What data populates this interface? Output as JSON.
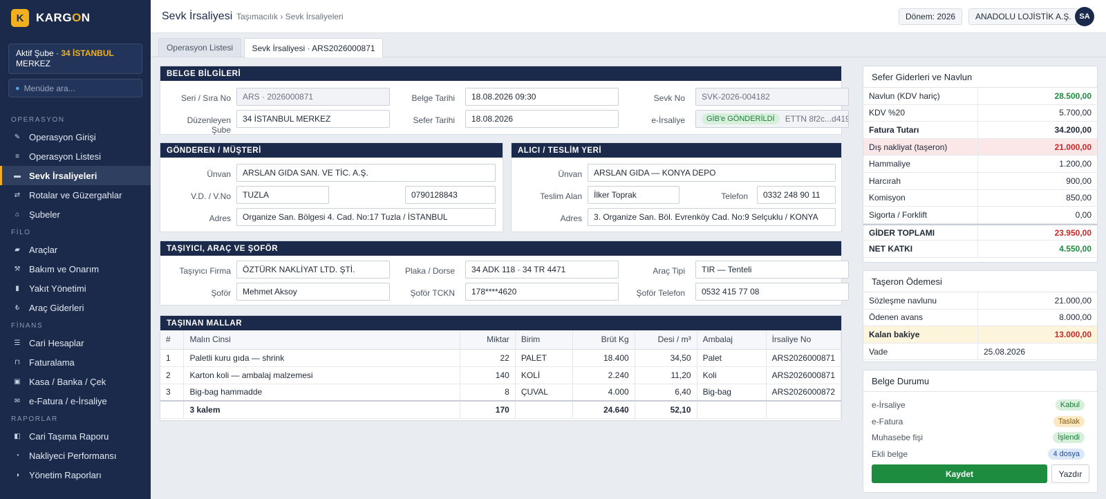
{
  "brand": {
    "logo_letter": "K",
    "name_a": "KARG",
    "name_b": "O",
    "name_c": "N"
  },
  "sidebar": {
    "branch_prefix": "Aktif Şube · ",
    "branch_code": "34 İSTANBUL",
    "branch_rest": "MERKEZ",
    "search_placeholder": "Menüde ara...",
    "sections": [
      {
        "label": "OPERASYON",
        "items": [
          {
            "label": "Operasyon Girişi",
            "icon": "pencil-icon",
            "glyph": "✎"
          },
          {
            "label": "Operasyon Listesi",
            "icon": "list-icon",
            "glyph": "≡"
          },
          {
            "label": "Sevk İrsaliyeleri",
            "icon": "document-icon",
            "glyph": "▬",
            "active": true
          },
          {
            "label": "Rotalar ve Güzergahlar",
            "icon": "swap-icon",
            "glyph": "⇄"
          },
          {
            "label": "Şubeler",
            "icon": "home-icon",
            "glyph": "⌂"
          }
        ]
      },
      {
        "label": "FİLO",
        "items": [
          {
            "label": "Araçlar",
            "icon": "truck-icon",
            "glyph": "▰"
          },
          {
            "label": "Bakım ve Onarım",
            "icon": "tools-icon",
            "glyph": "⚒"
          },
          {
            "label": "Yakıt Yönetimi",
            "icon": "fuel-icon",
            "glyph": "▮"
          },
          {
            "label": "Araç Giderleri",
            "icon": "lira-icon",
            "glyph": "₺"
          }
        ]
      },
      {
        "label": "FİNANS",
        "items": [
          {
            "label": "Cari Hesaplar",
            "icon": "ledger-icon",
            "glyph": "☰"
          },
          {
            "label": "Faturalama",
            "icon": "lock-icon",
            "glyph": "⊓"
          },
          {
            "label": "Kasa / Banka / Çek",
            "icon": "cash-icon",
            "glyph": "▣"
          },
          {
            "label": "e-Fatura / e-İrsaliye",
            "icon": "mail-icon",
            "glyph": "✉"
          }
        ]
      },
      {
        "label": "RAPORLAR",
        "items": [
          {
            "label": "Cari Taşıma Raporu",
            "icon": "report-icon",
            "glyph": "◧"
          },
          {
            "label": "Nakliyeci Performansı",
            "icon": "gauge-icon",
            "glyph": "◔"
          },
          {
            "label": "Yönetim Raporları",
            "icon": "pie-icon",
            "glyph": "◑"
          }
        ]
      }
    ]
  },
  "header": {
    "title": "Sevk İrsaliyesi",
    "breadcrumb": "Taşımacılık › Sevk İrsaliyeleri",
    "period": "Dönem: 2026",
    "company": "ANADOLU LOJİSTİK A.Ş.",
    "avatar": "SA"
  },
  "tabs": [
    "Operasyon Listesi",
    "Sevk İrsaliyesi · ARS2026000871"
  ],
  "doc": {
    "heading": "BELGE BİLGİLERİ",
    "serial_label": "Seri / Sıra No",
    "serial": "ARS · 2026000871",
    "doc_date_label": "Belge Tarihi",
    "doc_date": "18.08.2026 09:30",
    "ship_no_label": "Sevk No",
    "ship_no": "SVK-2026-004182",
    "branch_label": "Düzenleyen Şube",
    "branch": "34 İSTANBUL MERKEZ",
    "trip_date_label": "Sefer Tarihi",
    "trip_date": "18.08.2026",
    "eirs_label": "e-İrsaliye",
    "eirs_badge": "GİB'e GÖNDERİLDİ",
    "ettn": "ETTN 8f2c...d419"
  },
  "sender": {
    "heading": "GÖNDEREN / MÜŞTERİ",
    "title_label": "Ünvan",
    "title": "ARSLAN GIDA SAN. VE TİC. A.Ş.",
    "tax_label": "V.D. / V.No",
    "tax_office": "TUZLA",
    "tax_no": "0790128843",
    "addr_label": "Adres",
    "address": "Organize San. Bölgesi 4. Cad. No:17 Tuzla / İSTANBUL"
  },
  "receiver": {
    "heading": "ALICI / TESLİM YERİ",
    "title_label": "Ünvan",
    "title": "ARSLAN GIDA — KONYA DEPO",
    "recv_label": "Teslim Alan",
    "recv": "İlker Toprak",
    "phone_label": "Telefon",
    "phone": "0332 248 90 11",
    "addr_label": "Adres",
    "address": "3. Organize San. Böl. Evrenköy Cad. No:9 Selçuklu / KONYA"
  },
  "carrier": {
    "heading": "TAŞIYICI, ARAÇ VE ŞOFÖR",
    "firm_label": "Taşıyıcı Firma",
    "firm": "ÖZTÜRK NAKLİYAT LTD. ŞTİ.",
    "plate_label": "Plaka / Dorse",
    "plate": "34 ADK 118 · 34 TR 4471",
    "vtype_label": "Araç Tipi",
    "vtype": "TIR — Tenteli",
    "driver_label": "Şoför",
    "driver": "Mehmet Aksoy",
    "tckn_label": "Şoför TCKN",
    "tckn": "178****4620",
    "dphone_label": "Şoför Telefon",
    "dphone": "0532 415 77 08"
  },
  "goods": {
    "heading": "TAŞINAN MALLAR",
    "columns": [
      "#",
      "Malın Cinsi",
      "Miktar",
      "Birim",
      "Brüt Kg",
      "Desi / m³",
      "Ambalaj",
      "İrsaliye No"
    ],
    "rows": [
      [
        "1",
        "Paletli kuru gıda — shrink",
        "22",
        "PALET",
        "18.400",
        "34,50",
        "Palet",
        "ARS2026000871"
      ],
      [
        "2",
        "Karton koli — ambalaj malzemesi",
        "140",
        "KOLİ",
        "2.240",
        "11,20",
        "Koli",
        "ARS2026000871"
      ],
      [
        "3",
        "Big-bag hammadde",
        "8",
        "ÇUVAL",
        "4.000",
        "6,40",
        "Big-bag",
        "ARS2026000872"
      ]
    ],
    "total": {
      "label": "3 kalem",
      "qty": "170",
      "kg": "24.640",
      "desi": "52,10"
    }
  },
  "costs": {
    "title": "Sefer Giderleri ve Navlun",
    "rows": [
      {
        "label": "Navlun (KDV hariç)",
        "value": "28.500,00",
        "style": "pos"
      },
      {
        "label": "KDV %20",
        "value": "5.700,00"
      },
      {
        "label": "Fatura Tutarı",
        "value": "34.200,00",
        "style": "bold"
      },
      {
        "label": "Dış nakliyat (taşeron)",
        "value": "21.000,00",
        "style": "danger"
      },
      {
        "label": "Hammaliye",
        "value": "1.200,00"
      },
      {
        "label": "Harcırah",
        "value": "900,00"
      },
      {
        "label": "Komisyon",
        "value": "850,00"
      },
      {
        "label": "Sigorta / Forklift",
        "value": "0,00"
      },
      {
        "label": "GİDER TOPLAMI",
        "value": "23.950,00",
        "style": "sum-neg"
      },
      {
        "label": "NET KATKI",
        "value": "4.550,00",
        "style": "bold-pos"
      }
    ]
  },
  "sub": {
    "title": "Taşeron Ödemesi",
    "rows": [
      {
        "label": "Sözleşme navlunu",
        "value": "21.000,00"
      },
      {
        "label": "Ödenen avans",
        "value": "8.000,00"
      },
      {
        "label": "Kalan bakiye",
        "value": "13.000,00",
        "style": "warn"
      },
      {
        "label": "Vade",
        "value": "25.08.2026",
        "style": "date"
      }
    ]
  },
  "status": {
    "title": "Belge Durumu",
    "rows": [
      {
        "label": "e-İrsaliye",
        "badge": "Kabul",
        "color": "green"
      },
      {
        "label": "e-Fatura",
        "badge": "Taslak",
        "color": "amber"
      },
      {
        "label": "Muhasebe fişi",
        "badge": "İşlendi",
        "color": "green"
      },
      {
        "label": "Ekli belge",
        "badge": "4 dosya",
        "color": "blue"
      }
    ],
    "save": "Kaydet",
    "print": "Yazdır"
  }
}
